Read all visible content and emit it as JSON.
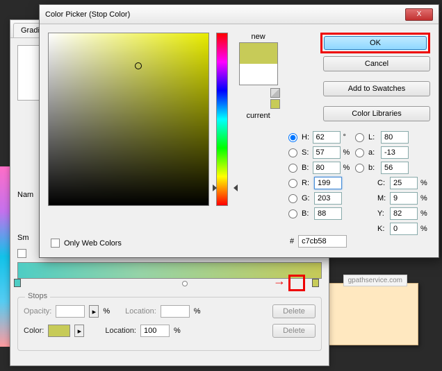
{
  "domain": "Computer-Use",
  "gradient_editor": {
    "tab": "Gradie",
    "name_partial": "Nam",
    "sm_partial": "Sm",
    "stops": {
      "legend": "Stops",
      "opacity_label": "Opacity:",
      "opacity_unit": "%",
      "location_label_1": "Location:",
      "location_unit_1": "%",
      "delete_1": "Delete",
      "color_label": "Color:",
      "location_label_2": "Location:",
      "location_value_2": "100",
      "location_unit_2": "%",
      "delete_2": "Delete"
    }
  },
  "picker": {
    "title": "Color Picker (Stop Color)",
    "close": "X",
    "new_label": "new",
    "current_label": "current",
    "buttons": {
      "ok": "OK",
      "cancel": "Cancel",
      "add_swatches": "Add to Swatches",
      "color_libraries": "Color Libraries"
    },
    "hsb": {
      "h_label": "H:",
      "h": "62",
      "h_unit": "°",
      "s_label": "S:",
      "s": "57",
      "s_unit": "%",
      "b_label": "B:",
      "b": "80",
      "b_unit": "%"
    },
    "lab": {
      "l_label": "L:",
      "l": "80",
      "a_label": "a:",
      "a": "-13",
      "b_label": "b:",
      "b": "56"
    },
    "rgb": {
      "r_label": "R:",
      "r": "199",
      "g_label": "G:",
      "g": "203",
      "b_label": "B:",
      "b": "88"
    },
    "cmyk": {
      "c_label": "C:",
      "c": "25",
      "unit": "%",
      "m_label": "M:",
      "m": "9",
      "y_label": "Y:",
      "y": "82",
      "k_label": "K:",
      "k": "0"
    },
    "only_web": "Only Web Colors",
    "hex_hash": "#",
    "hex": "c7cb58"
  },
  "back": {
    "url_fragment": "gpathservice.com"
  }
}
